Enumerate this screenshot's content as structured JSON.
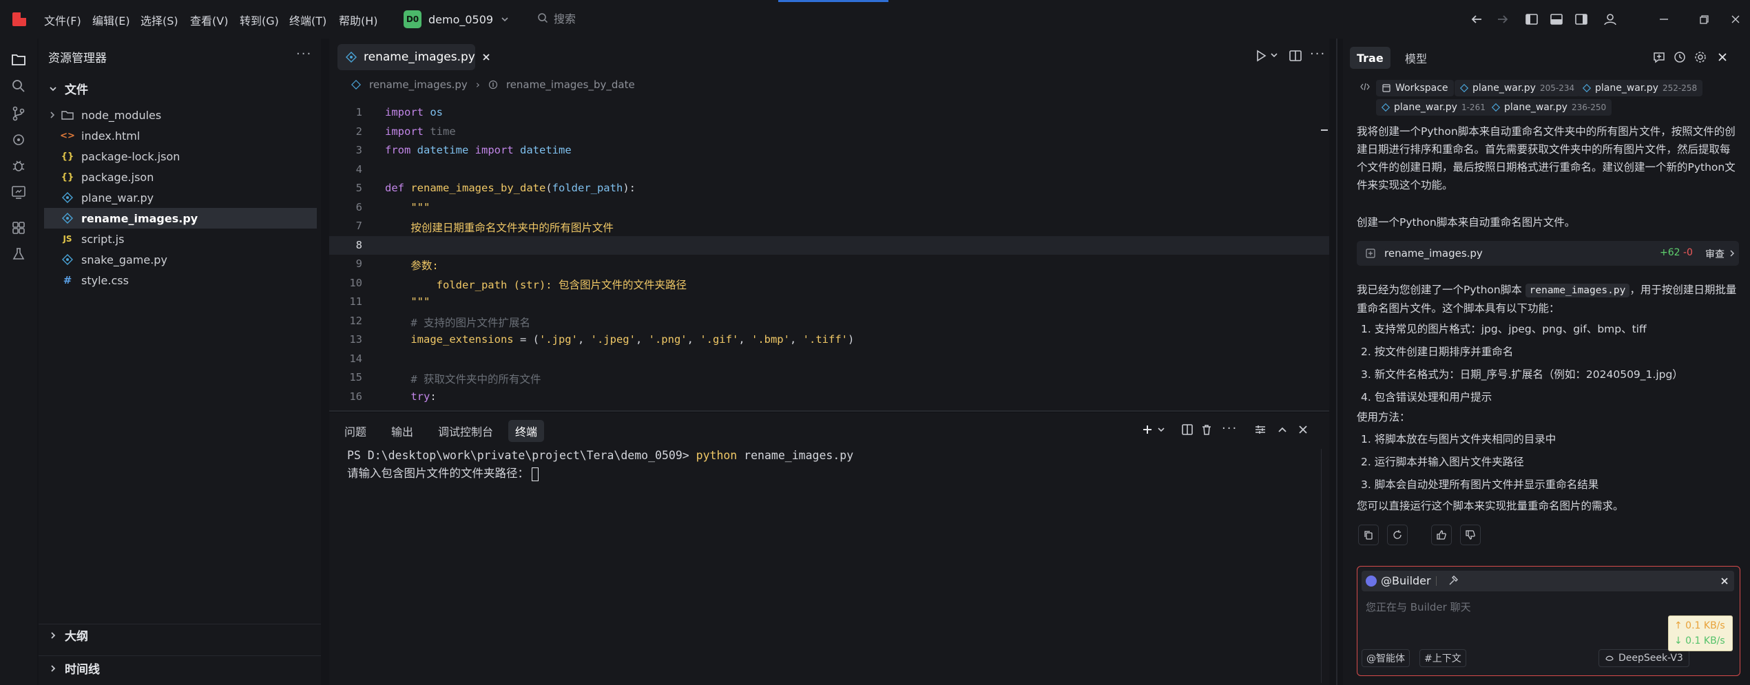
{
  "colors": {
    "bg": "#141519",
    "panel": "#17181c",
    "accent_red": "#e83b3b",
    "project_badge": "#4bb86a",
    "added": "#5fd06e",
    "removed": "#f05a5a",
    "chat_input_border": "#d64b4b",
    "speed_up": "#e8a23a",
    "speed_down": "#55c26a"
  },
  "titlebar": {
    "menu": [
      "文件(F)",
      "编辑(E)",
      "选择(S)",
      "查看(V)",
      "转到(G)",
      "终端(T)",
      "帮助(H)"
    ],
    "project_badge": "D0",
    "project_name": "demo_0509",
    "search_placeholder": "搜索"
  },
  "explorer": {
    "title": "资源管理器",
    "section_files": "文件",
    "items": [
      {
        "name": "node_modules",
        "icon": "folder-icon"
      },
      {
        "name": "index.html",
        "icon": "html-icon"
      },
      {
        "name": "package-lock.json",
        "icon": "json-icon"
      },
      {
        "name": "package.json",
        "icon": "json-icon"
      },
      {
        "name": "plane_war.py",
        "icon": "python-icon"
      },
      {
        "name": "rename_images.py",
        "icon": "python-icon",
        "selected": true
      },
      {
        "name": "script.js",
        "icon": "js-icon"
      },
      {
        "name": "snake_game.py",
        "icon": "python-icon"
      },
      {
        "name": "style.css",
        "icon": "css-icon"
      }
    ],
    "section_outline": "大纲",
    "section_timeline": "时间线"
  },
  "editor": {
    "tab_label": "rename_images.py",
    "breadcrumb_file": "rename_images.py",
    "breadcrumb_symbol": "rename_images_by_date",
    "current_line": 8,
    "lines": [
      {
        "n": "1",
        "t": "import os"
      },
      {
        "n": "2",
        "t": "import time"
      },
      {
        "n": "3",
        "t": "from datetime import datetime"
      },
      {
        "n": "4",
        "t": ""
      },
      {
        "n": "5",
        "t": "def rename_images_by_date(folder_path):"
      },
      {
        "n": "6",
        "t": "    \"\"\""
      },
      {
        "n": "7",
        "t": "    按创建日期重命名文件夹中的所有图片文件"
      },
      {
        "n": "8",
        "t": ""
      },
      {
        "n": "9",
        "t": "    参数:"
      },
      {
        "n": "10",
        "t": "        folder_path (str): 包含图片文件的文件夹路径"
      },
      {
        "n": "11",
        "t": "    \"\"\""
      },
      {
        "n": "12",
        "t": "    # 支持的图片文件扩展名"
      },
      {
        "n": "13",
        "t": "    image_extensions = ('.jpg', '.jpeg', '.png', '.gif', '.bmp', '.tiff')"
      },
      {
        "n": "14",
        "t": ""
      },
      {
        "n": "15",
        "t": "    # 获取文件夹中的所有文件"
      },
      {
        "n": "16",
        "t": "    try:"
      }
    ]
  },
  "terminal": {
    "tabs": [
      "问题",
      "输出",
      "调试控制台",
      "终端"
    ],
    "active_tab": "终端",
    "prompt": "PS D:\\desktop\\work\\private\\project\\Tera\\demo_0509>",
    "command_exe": "python",
    "command_args": " rename_images.py",
    "input_prompt": "请输入包含图片文件的文件夹路径："
  },
  "chat": {
    "tabs": [
      "Trae",
      "模型"
    ],
    "context_workspace": "Workspace",
    "context_files": [
      {
        "name": "plane_war.py",
        "range": "205-234"
      },
      {
        "name": "plane_war.py",
        "range": "252-258"
      },
      {
        "name": "plane_war.py",
        "range": "1-261"
      },
      {
        "name": "plane_war.py",
        "range": "236-250"
      }
    ],
    "intro_paragraph": "我将创建一个Python脚本来自动重命名文件夹中的所有图片文件，按照文件的创建日期进行排序和重命名。首先需要获取文件夹中的所有图片文件，然后提取每个文件的创建日期，最后按照日期格式进行重命名。建议创建一个新的Python文件来实现这个功能。",
    "create_line": "创建一个Python脚本来自动重命名图片文件。",
    "file_card": {
      "name": "rename_images.py",
      "added": "+62",
      "removed": "-0",
      "review": "审查"
    },
    "result_pre": "我已经为您创建了一个Python脚本",
    "result_code": "rename_images.py",
    "result_post": "，用于按创建日期批量重命名图片文件。这个脚本具有以下功能：",
    "features": [
      "1. 支持常见的图片格式：jpg、jpeg、png、gif、bmp、tiff",
      "2. 按文件创建日期排序并重命名",
      "3. 新文件名格式为：日期_序号.扩展名（例如：20240509_1.jpg）",
      "4. 包含错误处理和用户提示"
    ],
    "usage_title": "使用方法：",
    "usage": [
      "1. 将脚本放在与图片文件夹相同的目录中",
      "2. 运行脚本并输入图片文件夹路径",
      "3. 脚本会自动处理所有图片文件并显示重命名结果"
    ],
    "closing": "您可以直接运行这个脚本来实现批量重命名图片的需求。",
    "input": {
      "agent": "@Builder",
      "placeholder": "您正在与 Builder 聊天",
      "agent_button": "@智能体",
      "context_button": "#上下文",
      "model": "DeepSeek-V3"
    },
    "net_up": "↑ 0.1 KB/s",
    "net_down": "↓ 0.1 KB/s"
  }
}
